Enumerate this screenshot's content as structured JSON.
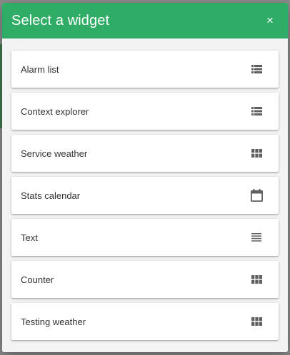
{
  "dialog": {
    "title": "Select a widget",
    "close_glyph": "×"
  },
  "colors": {
    "header": "#2fac66",
    "body": "#f3f3f3",
    "icon": "#5f5f5f"
  },
  "widgets": [
    {
      "label": "Alarm list",
      "icon": "list-icon"
    },
    {
      "label": "Context explorer",
      "icon": "list-icon"
    },
    {
      "label": "Service weather",
      "icon": "grid-icon"
    },
    {
      "label": "Stats calendar",
      "icon": "calendar-icon"
    },
    {
      "label": "Text",
      "icon": "text-lines-icon"
    },
    {
      "label": "Counter",
      "icon": "grid-icon"
    },
    {
      "label": "Testing weather",
      "icon": "grid-icon"
    }
  ]
}
